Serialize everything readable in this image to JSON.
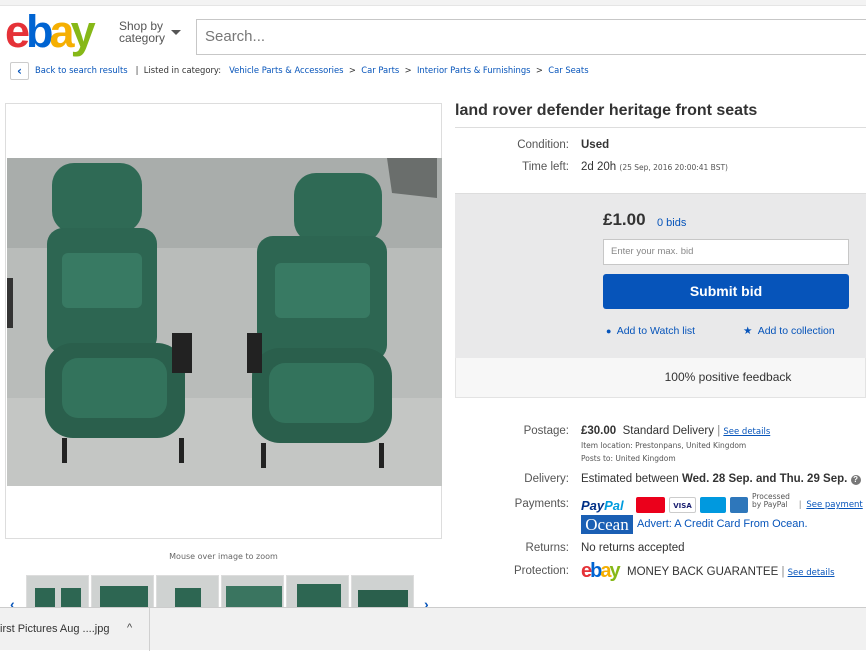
{
  "header": {
    "logo": {
      "e": "e",
      "b": "b",
      "a": "a",
      "y": "y"
    },
    "shop_by_line1": "Shop by",
    "shop_by_line2": "category",
    "search_placeholder": "Search..."
  },
  "breadcrumb": {
    "back": "Back to search results",
    "divider": "|",
    "listed_in": "Listed in category:",
    "items": [
      "Vehicle Parts & Accessories",
      "Car Parts",
      "Interior Parts & Furnishings",
      "Car Seats"
    ],
    "separator": ">"
  },
  "gallery": {
    "zoom_hint": "Mouse over image to zoom"
  },
  "listing": {
    "title": "land rover defender heritage front seats",
    "condition_label": "Condition:",
    "condition_value": "Used",
    "time_left_label": "Time left:",
    "time_left_value": "2d 20h",
    "time_left_end": "(25 Sep, 2016  20:00:41 BST)"
  },
  "bid": {
    "price": "£1.00",
    "bids": "0 bids",
    "input_placeholder": "Enter your max. bid",
    "submit_label": "Submit bid",
    "watch_label": "Add to Watch list",
    "collection_label": "Add to collection",
    "feedback": "100% positive feedback"
  },
  "details": {
    "postage_label": "Postage:",
    "postage_price": "£30.00",
    "postage_method": "Standard Delivery",
    "see_details": "See details",
    "item_location": "Item location:  Prestonpans, United Kingdom",
    "posts_to": "Posts to:  United Kingdom",
    "delivery_label": "Delivery:",
    "delivery_prefix": "Estimated between",
    "delivery_dates": "Wed. 28 Sep. and Thu. 29 Sep.",
    "payments_label": "Payments:",
    "paypal_pay": "Pay",
    "paypal_pal": "Pal",
    "card_visa": "VISA",
    "processed_by": "Processed by PayPal",
    "see_payment": "See payment",
    "ocean": "Ocean",
    "advert": "Advert: A Credit Card From Ocean.",
    "returns_label": "Returns:",
    "returns_value": "No returns accepted",
    "protection_label": "Protection:",
    "money_back": "MONEY BACK GUARANTEE",
    "see_details_2": "See details"
  },
  "download_bar": {
    "file": "irst Pictures Aug ....jpg"
  },
  "colors": {
    "ebay_red": "#e53238",
    "ebay_blue": "#0064d2",
    "ebay_yellow": "#f5af02",
    "ebay_green": "#86b817",
    "link_blue": "#0654ba",
    "button_blue": "#0654ba"
  }
}
